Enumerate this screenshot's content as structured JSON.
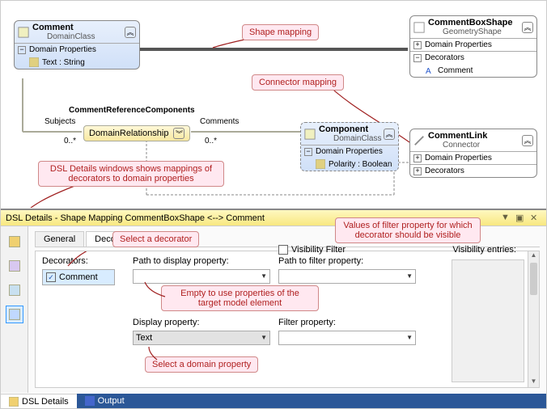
{
  "diagram": {
    "comment_box": {
      "title": "Comment",
      "subtitle": "DomainClass",
      "section": "Domain Properties",
      "item": "Text : String"
    },
    "component_box": {
      "title": "Component",
      "subtitle": "DomainClass",
      "section": "Domain Properties",
      "item": "Polarity : Boolean"
    },
    "commentboxshape": {
      "title": "CommentBoxShape",
      "subtitle": "GeometryShape",
      "section1": "Domain Properties",
      "section2": "Decorators",
      "item": "Comment"
    },
    "commentlink": {
      "title": "CommentLink",
      "subtitle": "Connector",
      "section1": "Domain Properties",
      "section2": "Decorators"
    },
    "relationship": {
      "heading": "CommentReferenceComponents",
      "label": "DomainRelationship",
      "left_role": "Subjects",
      "left_mult": "0..*",
      "right_role": "Comments",
      "right_mult": "0..*"
    },
    "callouts": {
      "shape_mapping": "Shape mapping",
      "connector_mapping": "Connector mapping",
      "dsl_details_desc": "DSL Details windows shows mappings of decorators to domain properties",
      "select_decorator": "Select a decorator",
      "empty_props": "Empty to use properties of the target model element",
      "select_domain_prop": "Select a domain property",
      "values_filter": "Values of filter property for which decorator should be visible"
    }
  },
  "dsl": {
    "title": "DSL Details - Shape Mapping CommentBoxShape <--> Comment",
    "tabs": {
      "general": "General",
      "decorator_maps": "Decorator Maps"
    },
    "labels": {
      "decorators": "Decorators:",
      "path_display": "Path to display property:",
      "display_property": "Display property:",
      "visibility_filter": "Visibility Filter",
      "path_filter": "Path to filter property:",
      "filter_property": "Filter property:",
      "visibility_entries": "Visibility entries:"
    },
    "values": {
      "decorator_item": "Comment",
      "display_property_value": "Text"
    }
  },
  "bottom": {
    "dsl_details": "DSL Details",
    "output": "Output"
  }
}
